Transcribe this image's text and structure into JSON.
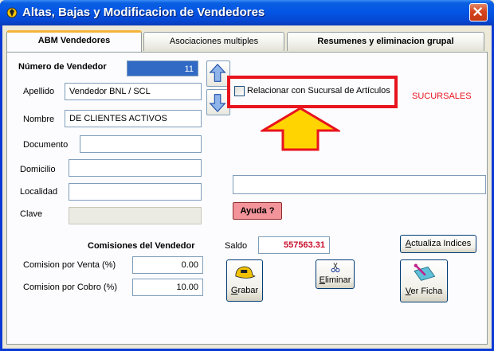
{
  "window": {
    "title": "Altas, Bajas y Modificacion de Vendedores",
    "app_icon": "app-gear-icon",
    "close_icon": "close-icon"
  },
  "tabs": [
    {
      "label": "ABM Vendedores",
      "active": true
    },
    {
      "label": "Asociaciones multiples",
      "active": false
    },
    {
      "label": "Resumenes y eliminacion grupal",
      "active": false
    }
  ],
  "form": {
    "numero_label": "Número de Vendedor",
    "numero_value": "11",
    "apellido_label": "Apellido",
    "apellido_value": "Vendedor BNL / SCL",
    "nombre_label": "Nombre",
    "nombre_value": "DE CLIENTES ACTIVOS",
    "documento_label": "Documento",
    "documento_value": "",
    "domicilio_label": "Domicilio",
    "domicilio_value": "",
    "localidad_label": "Localidad",
    "localidad_value": "",
    "clave_label": "Clave",
    "clave_value": ""
  },
  "nav": {
    "up_icon": "arrow-up-icon",
    "down_icon": "arrow-down-icon"
  },
  "relacion": {
    "checkbox_label": "Relacionar con  Sucursal de Artículos",
    "checked": false,
    "sucursales_label": "SUCURSALES",
    "sucursales_color": "#e8141e",
    "extra_field_value": ""
  },
  "ayuda_label": "Ayuda ?",
  "comisiones": {
    "title": "Comisiones del Vendedor",
    "venta_label": "Comision por Venta (%)",
    "venta_value": "0.00",
    "cobro_label": "Comision por Cobro (%)",
    "cobro_value": "10.00"
  },
  "saldo": {
    "label": "Saldo",
    "value": "557563.31",
    "color": "#c8102e"
  },
  "buttons": {
    "actualiza_accel": "A",
    "actualiza_rest": "ctualiza Indices",
    "grabar_accel": "G",
    "grabar_rest": "rabar",
    "grabar_icon": "cap-icon",
    "eliminar_accel": "E",
    "eliminar_rest": "liminar",
    "eliminar_icon": "scissors-icon",
    "verficha_accel": "V",
    "verficha_rest": "er Ficha",
    "verficha_icon": "edit-card-icon"
  },
  "annotation": {
    "highlight_color": "#e8141e",
    "arrow_color": "#ffd400",
    "arrow_icon": "arrow-up-callout-icon"
  }
}
